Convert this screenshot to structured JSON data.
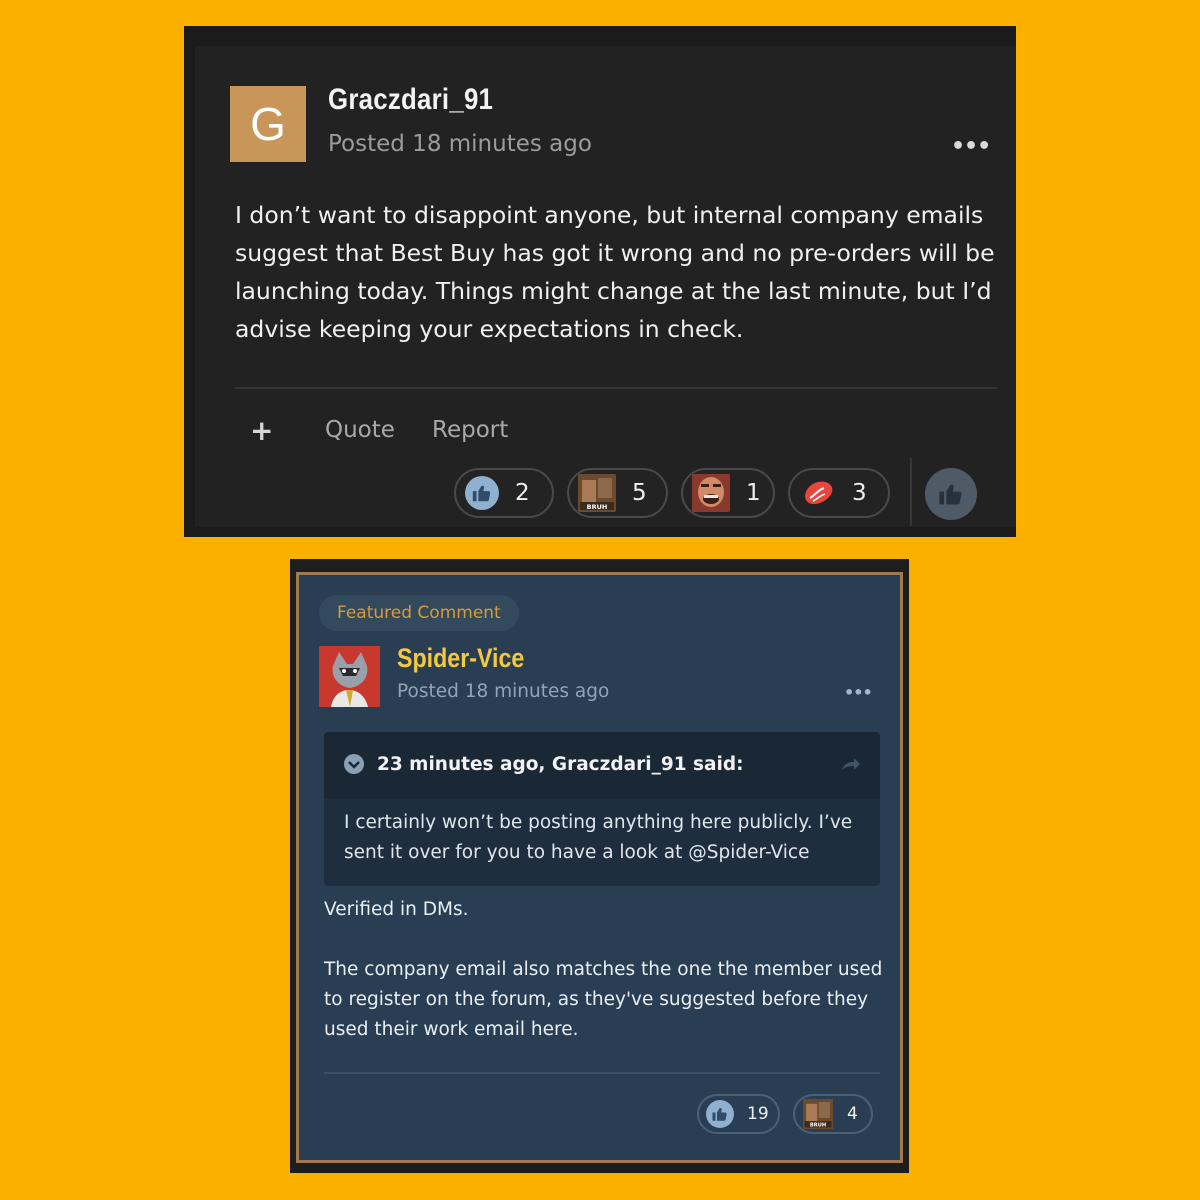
{
  "post1": {
    "avatar_letter": "G",
    "author": "Graczdari_91",
    "meta": "Posted 18 minutes ago",
    "more_icon": "•••",
    "body": "I don’t want to disappoint anyone, but internal company emails suggest that Best Buy has got it wrong and no pre-orders will be launching today. Things might change at the last minute, but I’d advise keeping your expectations in check.",
    "actions": {
      "plus": "+",
      "quote": "Quote",
      "report": "Report"
    },
    "reactions": [
      {
        "icon": "thumbs-up-icon",
        "count": "2"
      },
      {
        "icon": "bruh-reaction-icon",
        "count": "5"
      },
      {
        "icon": "laughing-face-reaction-icon",
        "count": "1"
      },
      {
        "icon": "steak-reaction-icon",
        "count": "3"
      }
    ]
  },
  "post2": {
    "badge": "Featured Comment",
    "author": "Spider-Vice",
    "meta": "Posted 18 minutes ago",
    "more_icon": "•••",
    "quote": {
      "title": "23 minutes ago, Graczdari_91 said:",
      "text": "I certainly won’t be posting anything here publicly. I’ve sent it over for you to have a look at @Spider-Vice"
    },
    "body_line1": "Verified in DMs.",
    "body_line2": "The company email also matches the one the member used to register on the forum, as they've suggested before they used their work email here.",
    "reactions": [
      {
        "icon": "thumbs-up-icon",
        "count": "19"
      },
      {
        "icon": "bruh-reaction-icon",
        "count": "4"
      }
    ]
  },
  "colors": {
    "page_bg": "#fbb000",
    "post1_bg": "#222223",
    "post2_bg": "#293e53",
    "post2_author": "#f5c842",
    "badge_text": "#d99a3c"
  }
}
